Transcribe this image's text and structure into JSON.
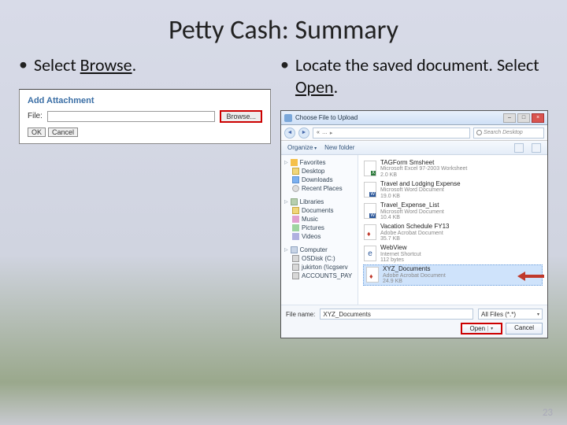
{
  "title": "Petty Cash: Summary",
  "left": {
    "bullet_prefix": "Select ",
    "bullet_underlined": "Browse",
    "bullet_suffix": ".",
    "panel": {
      "header": "Add Attachment",
      "file_label": "File:",
      "browse": "Browse...",
      "ok": "OK",
      "cancel": "Cancel"
    }
  },
  "right": {
    "bullet_prefix": "Locate the saved document. Select ",
    "bullet_underlined": "Open",
    "bullet_suffix": ".",
    "dialog": {
      "window_title": "Choose File to Upload",
      "breadcrumb": [
        "«",
        "…",
        "▸"
      ],
      "search_placeholder": "Search Desktop",
      "toolbar": {
        "organize": "Organize",
        "new_folder": "New folder"
      },
      "sidebar": {
        "favorites": {
          "label": "Favorites",
          "items": [
            "Desktop",
            "Downloads",
            "Recent Places"
          ]
        },
        "libraries": {
          "label": "Libraries",
          "items": [
            "Documents",
            "Music",
            "Pictures",
            "Videos"
          ]
        },
        "computer": {
          "label": "Computer",
          "items": [
            "OSDisk (C:)",
            "jukirton (\\\\cgserv",
            "ACCOUNTS_PAY"
          ]
        }
      },
      "files": [
        {
          "name": "TAGForm Smsheet",
          "sub": "Microsoft Excel 97-2003 Worksheet",
          "size": "2.0 KB",
          "type": "xls"
        },
        {
          "name": "Travel and Lodging Expense",
          "sub": "Microsoft Word Document",
          "size": "19.0 KB",
          "type": "doc"
        },
        {
          "name": "Travel_Expense_List",
          "sub": "Microsoft Word Document",
          "size": "10.4 KB",
          "type": "doc"
        },
        {
          "name": "Vacation Schedule FY13",
          "sub": "Adobe Acrobat Document",
          "size": "35.7 KB",
          "type": "pdf"
        },
        {
          "name": "WebView",
          "sub": "Internet Shortcut",
          "size": "112 bytes",
          "type": "short"
        },
        {
          "name": "XYZ_Documents",
          "sub": "Adobe Acrobat Document",
          "size": "24.9 KB",
          "type": "pdf",
          "selected": true
        }
      ],
      "footer": {
        "filename_label": "File name:",
        "filename_value": "XYZ_Documents",
        "filter": "All Files (*.*)",
        "open": "Open",
        "cancel": "Cancel"
      }
    }
  },
  "page_number": "23"
}
